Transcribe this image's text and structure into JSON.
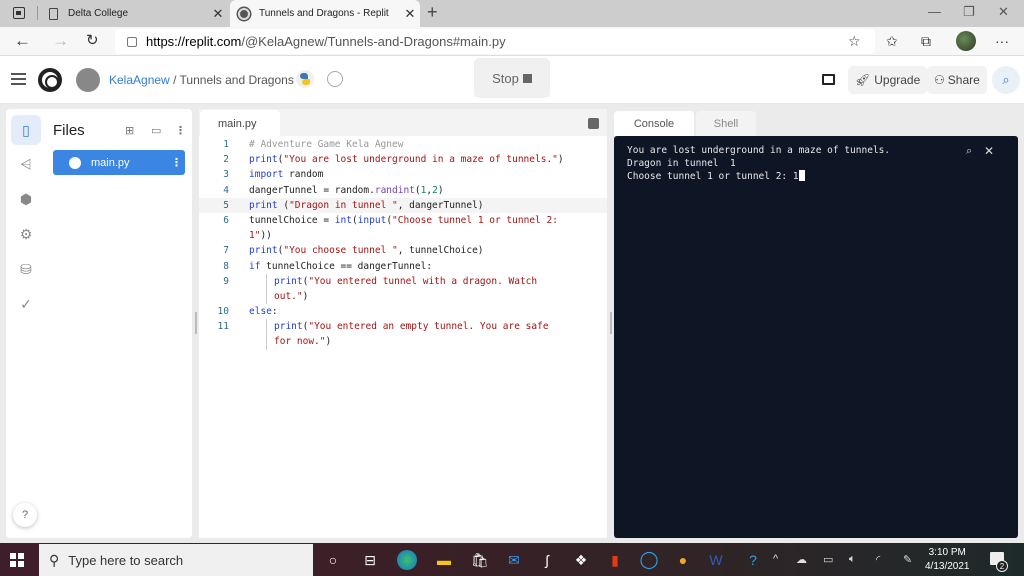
{
  "browser": {
    "tabs": [
      {
        "title": "Delta College",
        "active": false
      },
      {
        "title": "Tunnels and Dragons - Replit",
        "active": true
      }
    ],
    "new_tab_icon": "+",
    "url_host": "https://replit.com",
    "url_path": "/@KelaAgnew/Tunnels-and-Dragons#main.py",
    "window_controls": [
      "minimize",
      "restore",
      "close"
    ]
  },
  "header": {
    "user": "KelaAgnew",
    "separator": "/",
    "repl_name": "Tunnels and Dragons",
    "stop_label": "Stop",
    "upgrade_label": "Upgrade",
    "share_label": "Share"
  },
  "files": {
    "title": "Files",
    "items": [
      {
        "name": "main.py",
        "selected": true
      }
    ]
  },
  "editor": {
    "tab": "main.py",
    "lines": [
      {
        "n": "1",
        "html": "<span class='c-cmt'># Adventure Game Kela Agnew</span>"
      },
      {
        "n": "2",
        "html": "<span class='c-fn'>print</span><span class='c-plain'>(</span><span class='c-str'>\"You are lost underground in a maze of tunnels.\"</span><span class='c-plain'>)</span>"
      },
      {
        "n": "3",
        "html": "<span class='c-kw'>import</span><span class='c-plain'> random</span>"
      },
      {
        "n": "4",
        "html": "<span class='c-plain'>dangerTunnel = random.</span><span class='c-mth'>randint</span><span class='c-plain'>(</span><span class='c-num'>1</span><span class='c-plain'>,</span><span class='c-num'>2</span><span class='c-plain'>)</span>"
      },
      {
        "n": "5",
        "html": "<span class='c-fn'>print</span><span class='c-plain'> (</span><span class='c-str'>\"Dragon in tunnel \"</span><span class='c-plain'>, dangerTunnel)</span>",
        "highlight": true
      },
      {
        "n": "6",
        "html": "<span class='c-plain'>tunnelChoice = </span><span class='c-fn'>int</span><span class='c-plain'>(</span><span class='c-fn'>input</span><span class='c-plain'>(</span><span class='c-str'>\"Choose tunnel 1 or tunnel 2:</span>"
      },
      {
        "n": "",
        "html": "<span class='c-str'>1\"</span><span class='c-plain'>))</span>"
      },
      {
        "n": "7",
        "html": "<span class='c-fn'>print</span><span class='c-plain'>(</span><span class='c-str'>\"You choose tunnel \"</span><span class='c-plain'>, tunnelChoice)</span>"
      },
      {
        "n": "8",
        "html": "<span class='c-kw'>if</span><span class='c-plain'> tunnelChoice == dangerTunnel:</span>"
      },
      {
        "n": "9",
        "html": "<span class='c-fn'>print</span><span class='c-plain'>(</span><span class='c-str'>\"You entered tunnel with a dragon. Watch</span>",
        "indent": true
      },
      {
        "n": "",
        "html": "<span class='c-str'>out.\"</span><span class='c-plain'>)</span>",
        "indent": true
      },
      {
        "n": "10",
        "html": "<span class='c-kw'>else</span><span class='c-plain'>:</span>"
      },
      {
        "n": "11",
        "html": "<span class='c-fn'>print</span><span class='c-plain'>(</span><span class='c-str'>\"You entered an empty tunnel. You are safe</span>",
        "indent": true
      },
      {
        "n": "",
        "html": "<span class='c-str'>for now.\"</span><span class='c-plain'>)</span>",
        "indent": true
      }
    ]
  },
  "console": {
    "tabs": [
      "Console",
      "Shell"
    ],
    "active_tab": "Console",
    "lines": [
      "You are lost underground in a maze of tunnels.",
      "Dragon in tunnel  1",
      "Choose tunnel 1 or tunnel 2: 1"
    ]
  },
  "taskbar": {
    "search_placeholder": "Type here to search",
    "time": "3:10 PM",
    "date": "4/13/2021",
    "notification_count": "2",
    "pinned": [
      "edge",
      "file-explorer",
      "store",
      "mail",
      "app-s",
      "dropbox",
      "office",
      "cortana-ring",
      "browser-shield",
      "word",
      "help"
    ]
  }
}
